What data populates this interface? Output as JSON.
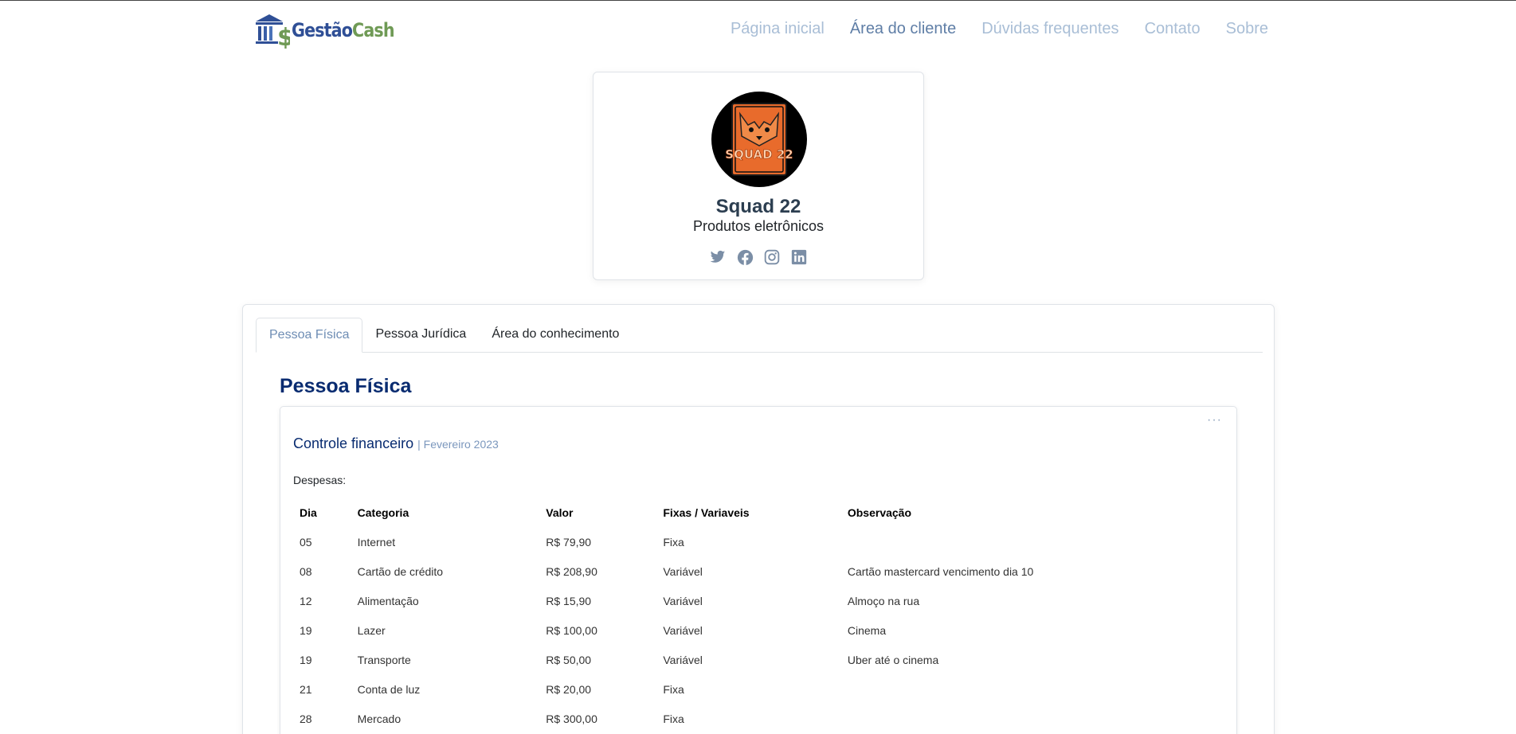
{
  "brand": {
    "part1": "Gestão",
    "part2": "Cash",
    "logo_icon": "bank-dollar-icon"
  },
  "nav": {
    "items": [
      {
        "label": "Página inicial",
        "active": false
      },
      {
        "label": "Área do cliente",
        "active": true
      },
      {
        "label": "Dúvidas frequentes",
        "active": false
      },
      {
        "label": "Contato",
        "active": false
      },
      {
        "label": "Sobre",
        "active": false
      }
    ]
  },
  "profile": {
    "name": "Squad 22",
    "description": "Produtos eletrônicos",
    "avatar_text": "SQUAD 22",
    "social_icons": [
      "twitter-icon",
      "facebook-icon",
      "instagram-icon",
      "linkedin-icon"
    ]
  },
  "tabs": [
    {
      "label": "Pessoa Física",
      "active": true
    },
    {
      "label": "Pessoa Jurídica",
      "active": false
    },
    {
      "label": "Área do conhecimento",
      "active": false
    }
  ],
  "section_title": "Pessoa Física",
  "finance_card": {
    "title": "Controle financeiro",
    "subtitle": "| Fevereiro 2023",
    "more": "···",
    "expenses_label": "Despesas:",
    "columns": [
      "Dia",
      "Categoria",
      "Valor",
      "Fixas / Variaveis",
      "Observação"
    ],
    "rows": [
      [
        "05",
        "Internet",
        "R$ 79,90",
        "Fixa",
        ""
      ],
      [
        "08",
        "Cartão de crédito",
        "R$ 208,90",
        "Variável",
        "Cartão mastercard vencimento dia 10"
      ],
      [
        "12",
        "Alimentação",
        "R$ 15,90",
        "Variável",
        "Almoço na rua"
      ],
      [
        "19",
        "Lazer",
        "R$ 100,00",
        "Variável",
        "Cinema"
      ],
      [
        "19",
        "Transporte",
        "R$ 50,00",
        "Variável",
        "Uber até o cinema"
      ],
      [
        "21",
        "Conta de luz",
        "R$ 20,00",
        "Fixa",
        ""
      ],
      [
        "28",
        "Mercado",
        "R$ 300,00",
        "Fixa",
        ""
      ]
    ]
  },
  "colors": {
    "accent": "#082b70",
    "nav_inactive": "#a9bed6",
    "nav_active": "#5f7ea6",
    "social": "#7b8ea6"
  }
}
